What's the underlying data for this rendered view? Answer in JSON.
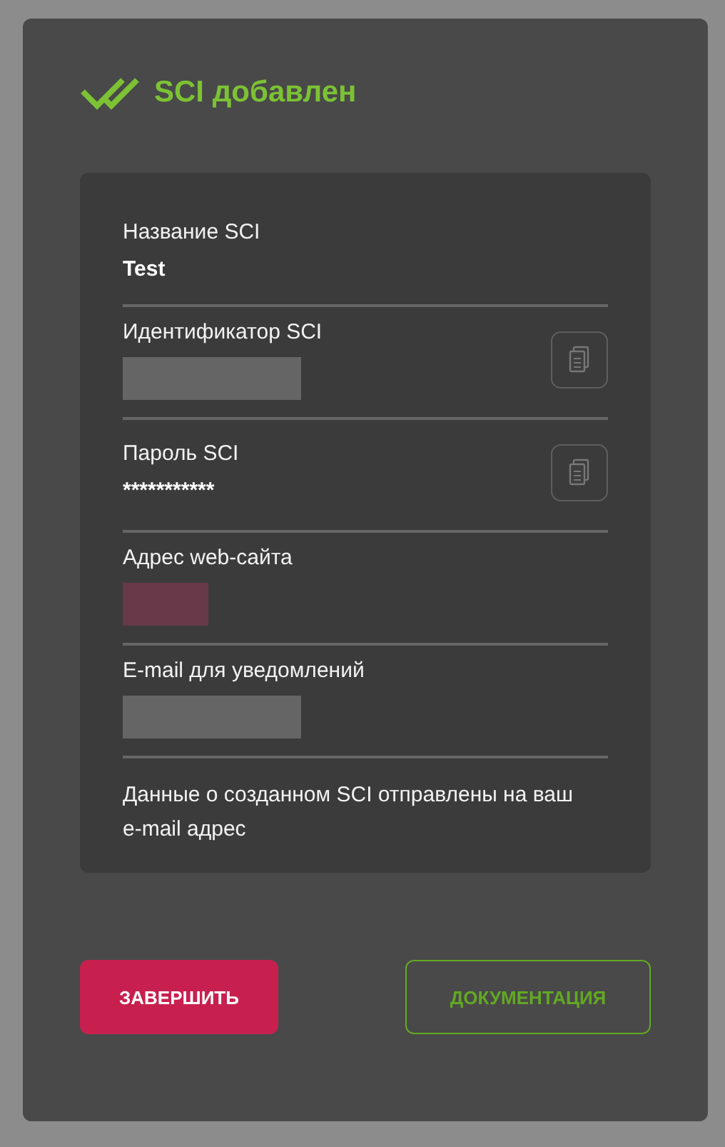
{
  "dialog": {
    "title": "SCI добавлен"
  },
  "fields": [
    {
      "label": "Название SCI",
      "value": "Test",
      "redacted": false,
      "copy": false
    },
    {
      "label": "Идентификатор SCI",
      "redacted": true,
      "color": "#6a6a6a",
      "copy": true
    },
    {
      "label": "Пароль SCI",
      "value": "***********",
      "redacted": false,
      "copy": true
    },
    {
      "label": "Адрес web-сайта",
      "redacted": true,
      "color": "#6e3a4a",
      "copy": false
    },
    {
      "label": "E-mail для уведомлений",
      "redacted": true,
      "color": "#6a6a6a",
      "copy": false
    }
  ],
  "note": "Данные о созданном SCI отправлены на ваш e-mail адрес",
  "buttons": [
    {
      "label": "ЗАВЕРШИТЬ",
      "kind": "primary"
    },
    {
      "label": "ДОКУМЕНТАЦИЯ",
      "kind": "outline"
    }
  ]
}
